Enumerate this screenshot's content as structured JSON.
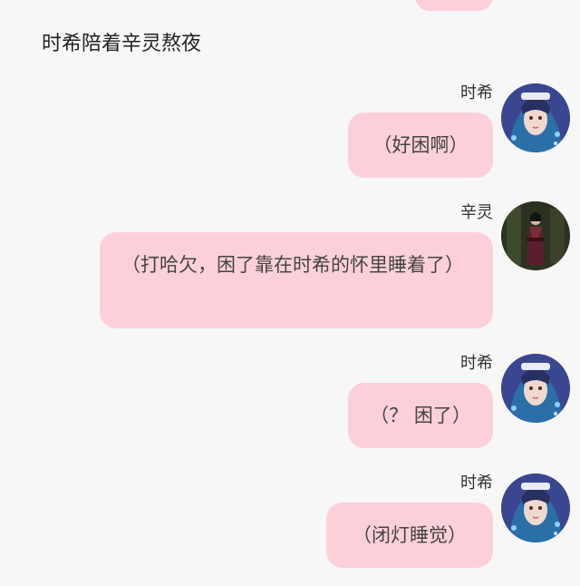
{
  "conversation": {
    "title": "时希陪着辛灵熬夜"
  },
  "messages": [
    {
      "sender": "时希",
      "text": "（好困啊）"
    },
    {
      "sender": "辛灵",
      "text": "（打哈欠，困了靠在时希的怀里睡着了）"
    },
    {
      "sender": "时希",
      "text": "（？ 困了）"
    },
    {
      "sender": "时希",
      "text": "（闭灯睡觉）"
    }
  ],
  "avatars": {
    "shixi_icon": "avatar-shixi-icon",
    "xinling_icon": "avatar-xinling-icon"
  },
  "colors": {
    "bubble": "#fdd0d9",
    "background": "#f7f7f7"
  }
}
